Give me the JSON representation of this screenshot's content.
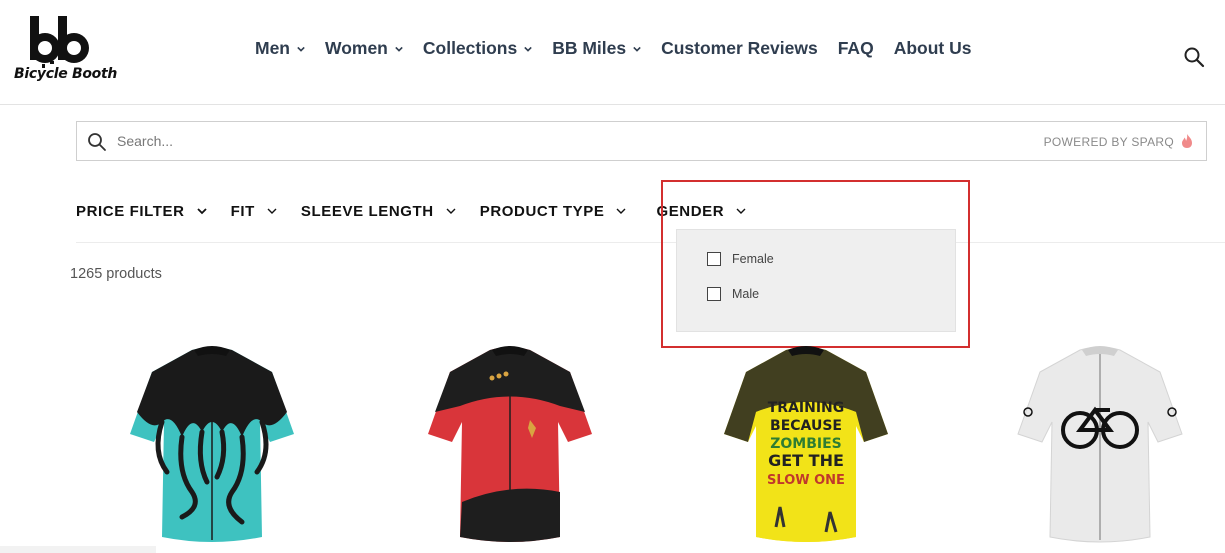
{
  "brand": {
    "name": "Bicycle Booth",
    "logo_letters": "bb"
  },
  "nav": {
    "items": [
      {
        "label": "Men",
        "has_dropdown": true
      },
      {
        "label": "Women",
        "has_dropdown": true
      },
      {
        "label": "Collections",
        "has_dropdown": true
      },
      {
        "label": "BB Miles",
        "has_dropdown": true
      },
      {
        "label": "Customer Reviews",
        "has_dropdown": false
      },
      {
        "label": "FAQ",
        "has_dropdown": false
      },
      {
        "label": "About Us",
        "has_dropdown": false
      }
    ],
    "search_icon": "search-icon"
  },
  "search": {
    "placeholder": "Search...",
    "value": "",
    "powered_by": "POWERED BY SPARQ",
    "powered_icon": "flame-icon"
  },
  "filters": [
    {
      "label": "PRICE FILTER"
    },
    {
      "label": "FIT"
    },
    {
      "label": "SLEEVE LENGTH"
    },
    {
      "label": "PRODUCT TYPE"
    },
    {
      "label": "GENDER",
      "expanded": true
    }
  ],
  "gender_dropdown": {
    "options": [
      {
        "label": "Female",
        "checked": false
      },
      {
        "label": "Male",
        "checked": false
      }
    ]
  },
  "results": {
    "count_text": "1265 products"
  },
  "products": [
    {
      "icon": "teal-octopus-jersey"
    },
    {
      "icon": "red-black-starfleet-jersey"
    },
    {
      "icon": "yellow-zombie-jersey",
      "print_lines": [
        "TRAINING",
        "BECAUSE",
        "ZOMBIES",
        "GET THE",
        "SLOW ONE"
      ]
    },
    {
      "icon": "white-bicycle-jersey"
    }
  ],
  "colors": {
    "accent_red": "#d32f2f",
    "nav_text": "#2f3d4f",
    "teal": "#3ec2c0",
    "jersey_red": "#d9353a",
    "jersey_yellow": "#f2e318"
  }
}
